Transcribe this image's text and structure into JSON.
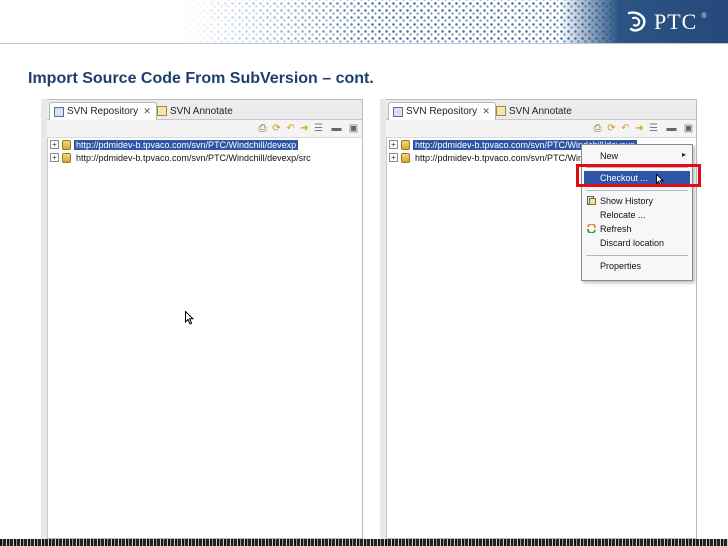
{
  "slide": {
    "title": "Import Source Code From SubVersion – cont.",
    "logo_text": "PTC",
    "logo_reg": "®"
  },
  "left_panel": {
    "tabs": [
      {
        "label": "SVN Repository",
        "icon": "repository-icon",
        "close": "✕",
        "active": true
      },
      {
        "label": "SVN Annotate",
        "icon": "annotate-icon",
        "active": false
      }
    ],
    "tree": [
      {
        "expander": "+",
        "label": "http://pdmidev-b.tpvaco.com/svn/PTC/Windchill/devexp",
        "selected": true
      },
      {
        "expander": "+",
        "label": "http://pdmidev-b.tpvaco.com/svn/PTC/Windchill/devexp/src",
        "selected": false
      }
    ]
  },
  "right_panel": {
    "tabs": [
      {
        "label": "SVN Repository",
        "icon": "repository-icon",
        "close": "✕",
        "active": true
      },
      {
        "label": "SVN Annotate",
        "icon": "annotate-icon",
        "active": false
      }
    ],
    "tree": [
      {
        "expander": "+",
        "label": "http://pdmidev-b.tpvaco.com/svn/PTC/Windchill/devexp",
        "selected": true
      },
      {
        "expander": "+",
        "label": "http://pdmidev-b.tpvaco.com/svn/PTC/Windchill/devexp/src",
        "selected": false
      }
    ],
    "context_menu": {
      "items": [
        {
          "label": "New",
          "submenu_arrow": "▸"
        },
        {
          "label": "Checkout ..."
        },
        {
          "label": "Show History"
        },
        {
          "label": "Relocate ..."
        },
        {
          "label": "Refresh"
        },
        {
          "label": "Discard location"
        },
        {
          "label": "Properties"
        }
      ]
    }
  },
  "colors": {
    "title": "#1f3f6b",
    "selection": "#2f55a9",
    "highlight_box": "#e20b16",
    "header_blue": "#2c5484"
  }
}
